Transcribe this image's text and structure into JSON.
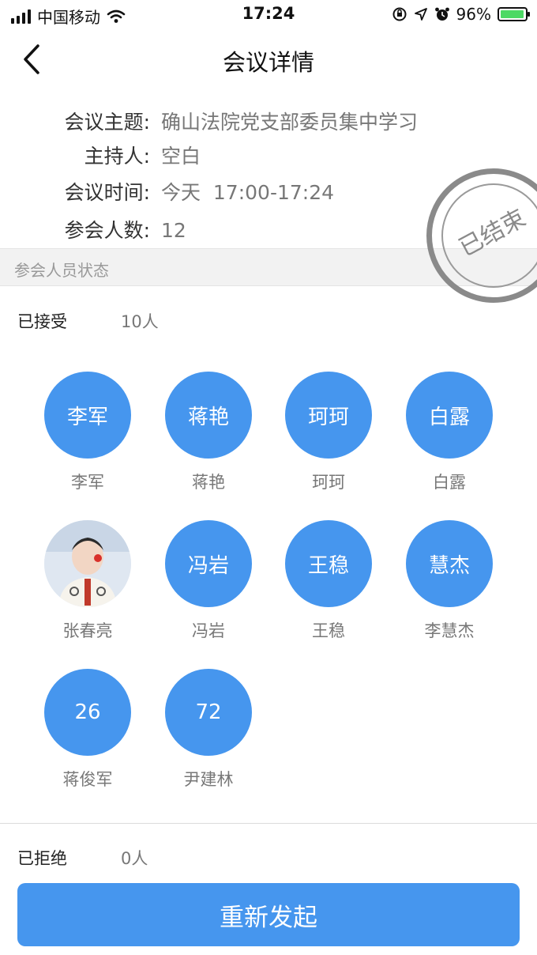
{
  "status_bar": {
    "carrier": "中国移动",
    "time": "17:24",
    "battery_percent": "96%",
    "battery_level": 0.96,
    "icons": [
      "signal-icon",
      "wifi-icon",
      "orientation-lock-icon",
      "location-icon",
      "alarm-icon",
      "battery-icon"
    ]
  },
  "nav": {
    "title": "会议详情",
    "back_icon": "chevron-left-icon"
  },
  "meeting": {
    "topic_label": "会议主题:",
    "topic": "确山法院党支部委员集中学习",
    "host_label": "主持人:",
    "host": "空白",
    "time_label": "会议时间:",
    "time": "今天  17:00-17:24",
    "count_label": "参会人数:",
    "count": "12",
    "stamp": "已结束"
  },
  "attendees": {
    "section_title": "参会人员状态",
    "accepted": {
      "label": "已接受",
      "count": "10人",
      "members": [
        {
          "avatar_text": "李军",
          "name": "李军"
        },
        {
          "avatar_text": "蒋艳",
          "name": "蒋艳"
        },
        {
          "avatar_text": "珂珂",
          "name": "珂珂"
        },
        {
          "avatar_text": "白露",
          "name": "白露"
        },
        {
          "avatar_text": "",
          "name": "张春亮"
        },
        {
          "avatar_text": "冯岩",
          "name": "冯岩"
        },
        {
          "avatar_text": "王稳",
          "name": "王稳"
        },
        {
          "avatar_text": "慧杰",
          "name": "李慧杰"
        },
        {
          "avatar_text": "26",
          "name": "蒋俊军"
        },
        {
          "avatar_text": "72",
          "name": "尹建林"
        }
      ]
    },
    "rejected": {
      "label": "已拒绝",
      "count": "0人"
    }
  },
  "actions": {
    "relaunch_label": "重新发起"
  },
  "colors": {
    "accent": "#4696ee",
    "stamp_gray": "#8a8a8a"
  }
}
